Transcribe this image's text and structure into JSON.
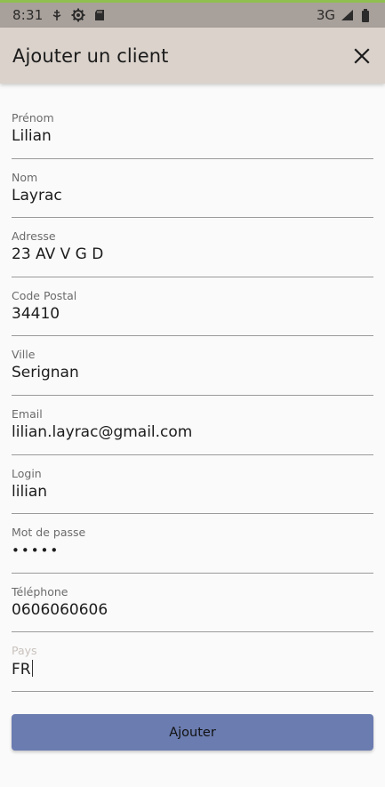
{
  "status_bar": {
    "time": "8:31",
    "icons": [
      "usb-debug-icon",
      "settings-gear-icon",
      "sd-card-icon"
    ],
    "network": "3G",
    "signal_icon": "signal-icon",
    "battery_icon": "battery-icon"
  },
  "app_bar": {
    "title": "Ajouter un client",
    "close_icon": "close-icon"
  },
  "form": {
    "fields": [
      {
        "label": "Prénom",
        "value": "Lilian"
      },
      {
        "label": "Nom",
        "value": "Layrac"
      },
      {
        "label": "Adresse",
        "value": "23 AV V G D"
      },
      {
        "label": "Code Postal",
        "value": "34410"
      },
      {
        "label": "Ville",
        "value": "Serignan"
      },
      {
        "label": "Email",
        "value": "lilian.layrac@gmail.com"
      },
      {
        "label": "Login",
        "value": "lilian"
      },
      {
        "label": "Mot de passe",
        "value": "•••••"
      },
      {
        "label": "Téléphone",
        "value": "0606060606"
      },
      {
        "label": "Pays",
        "value": "FR"
      }
    ]
  },
  "submit": {
    "label": "Ajouter"
  },
  "colors": {
    "status_bar": "#a8a09a",
    "app_bar": "#dad2cb",
    "background": "#fafafa",
    "button": "#6b7cb0",
    "divider": "#9a9a9a"
  }
}
